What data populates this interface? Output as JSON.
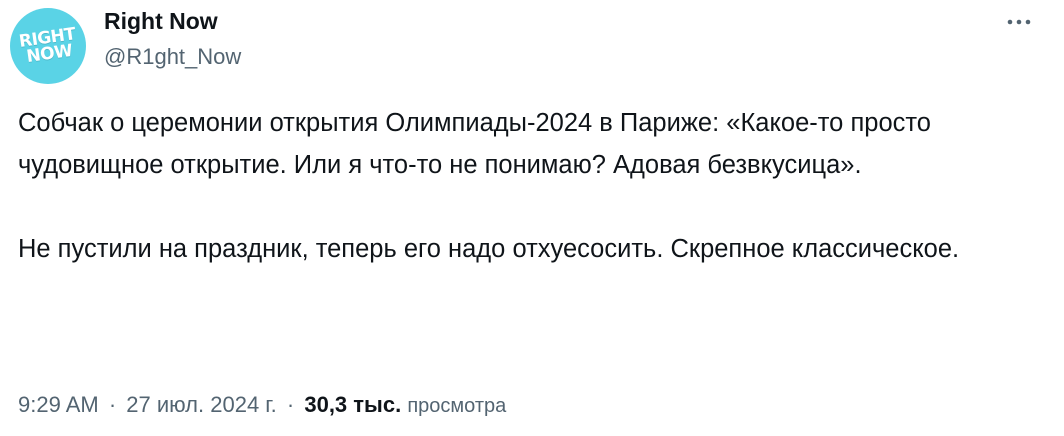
{
  "author": {
    "display_name": "Right Now",
    "handle": "@R1ght_Now",
    "avatar_text_line1": "RIGHT",
    "avatar_text_line2": "NOW"
  },
  "menu": {
    "icon": "more-horizontal-icon"
  },
  "tweet": {
    "paragraph1": "Собчак о церемонии открытия Олимпиады-2024 в Париже: «Какое-то просто чудовищное открытие. Или я что-то не понимаю? Адовая безвкусица».",
    "paragraph2": "Не пустили на праздник, теперь его надо отхуесосить. Скрепное классическое."
  },
  "meta": {
    "time": "9:29 AM",
    "date": "27 июл. 2024 г.",
    "separator": "·",
    "views_count": "30,3 тыс.",
    "views_label": "просмотра"
  },
  "colors": {
    "avatar_bg": "#5ad3e6",
    "text_primary": "#0f1419",
    "text_secondary": "#536471"
  }
}
